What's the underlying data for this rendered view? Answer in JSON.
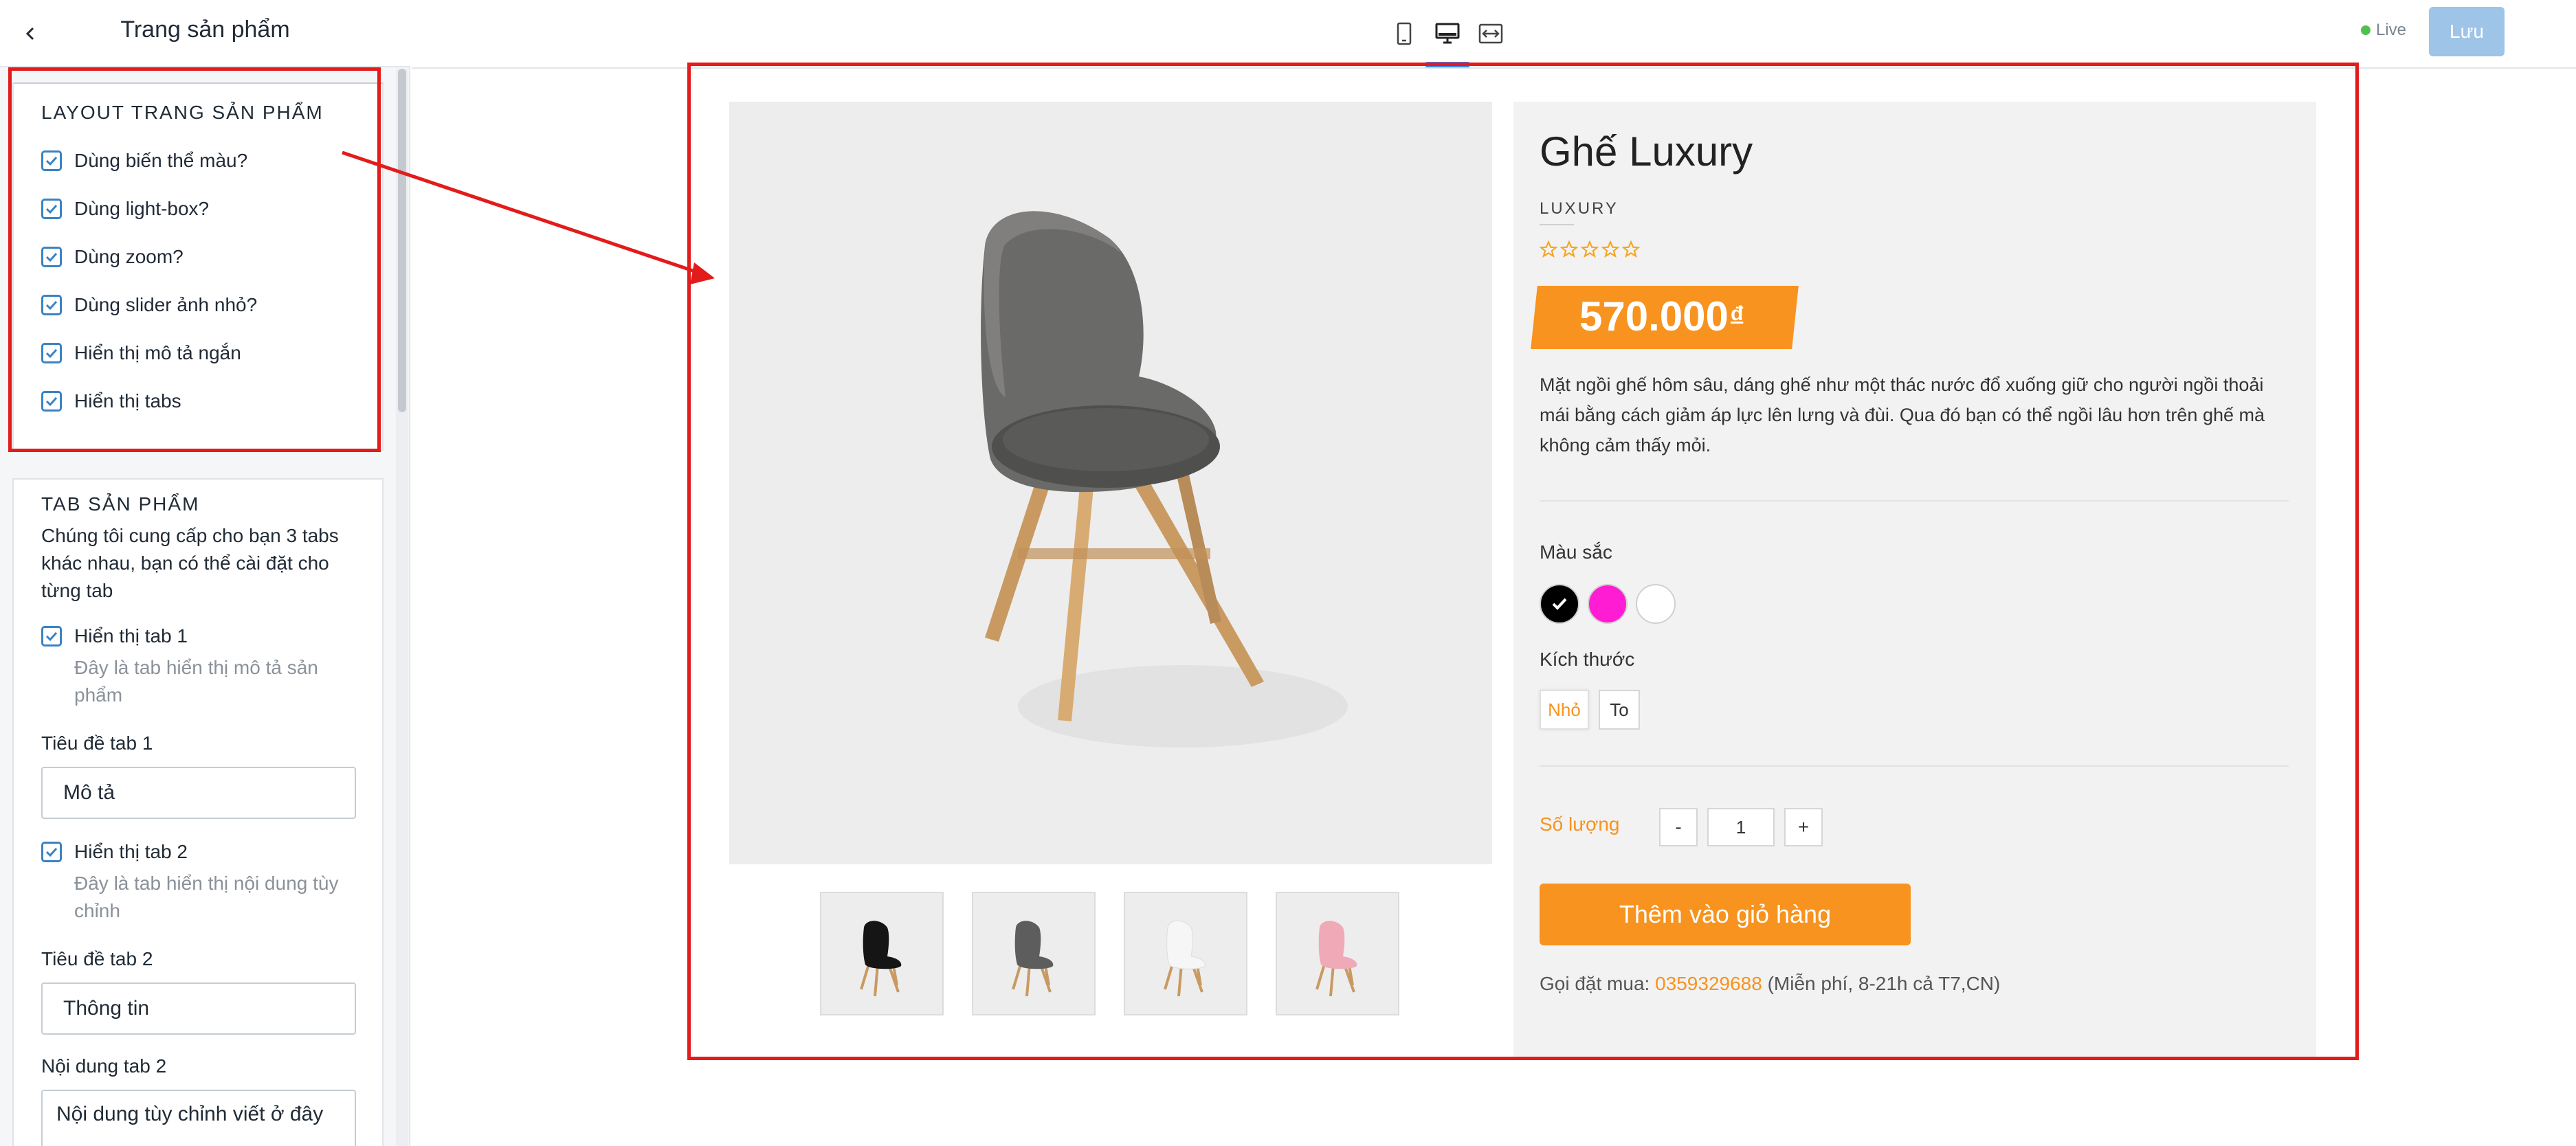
{
  "sidebar": {
    "title": "Trang sản phẩm",
    "layout_card": {
      "title": "LAYOUT TRANG SẢN PHẨM",
      "options": [
        {
          "label": "Dùng biến thể màu?",
          "checked": true
        },
        {
          "label": "Dùng light-box?",
          "checked": true
        },
        {
          "label": "Dùng zoom?",
          "checked": true
        },
        {
          "label": "Dùng slider ảnh nhỏ?",
          "checked": true
        },
        {
          "label": "Hiển thị mô tả ngắn",
          "checked": true
        },
        {
          "label": "Hiển thị tabs",
          "checked": true
        }
      ]
    },
    "tab_card": {
      "title": "TAB SẢN PHẨM",
      "description": "Chúng tôi cung cấp cho bạn 3 tabs khác nhau, bạn có thể cài đặt cho từng tab",
      "tab1_toggle": {
        "label": "Hiển thị tab 1",
        "help": "Đây là tab hiển thị mô tả sản phẩm",
        "checked": true
      },
      "tab1_title": {
        "label": "Tiêu đề tab 1",
        "value": "Mô tả"
      },
      "tab2_toggle": {
        "label": "Hiển thị tab 2",
        "help": "Đây là tab hiển thị nội dung tùy chỉnh",
        "checked": true
      },
      "tab2_title": {
        "label": "Tiêu đề tab 2",
        "value": "Thông tin"
      },
      "tab2_content": {
        "label": "Nội dung tab 2",
        "value": "Nội dung tùy chỉnh viết ở đây"
      }
    }
  },
  "topbar": {
    "devices": [
      "mobile-icon",
      "desktop-icon",
      "fullwidth-icon"
    ],
    "live_label": "Live",
    "save_label": "Lưu"
  },
  "product": {
    "title": "Ghế Luxury",
    "brand": "LUXURY",
    "rating_stars": 5,
    "rating_filled": 0,
    "price": "570.000",
    "currency": "đ",
    "description": "Mặt ngồi ghế hôm sâu, dáng ghế như một thác nước đổ xuống giữ cho người ngồi thoải mái bằng cách giảm áp lực lên lưng và đùi. Qua đó bạn có thể ngồi lâu hơn trên ghế mà không cảm thấy mỏi.",
    "color_label": "Màu sắc",
    "colors": [
      {
        "name": "black",
        "hex": "#000000",
        "selected": true
      },
      {
        "name": "magenta",
        "hex": "#ff1cd2",
        "selected": false
      },
      {
        "name": "white",
        "hex": "#ffffff",
        "selected": false
      }
    ],
    "size_label": "Kích thước",
    "sizes": [
      {
        "label": "Nhỏ",
        "selected": true
      },
      {
        "label": "To",
        "selected": false
      }
    ],
    "qty_label": "Số lượng",
    "qty_minus": "-",
    "qty_value": "1",
    "qty_plus": "+",
    "cart_label": "Thêm vào giỏ hàng",
    "call_prefix": "Gọi đặt mua:",
    "call_phone": "0359329688",
    "call_suffix": "(Miễn phí, 8-21h cả T7,CN)",
    "thumbnails": [
      {
        "name": "black-chair",
        "seat": "#151515"
      },
      {
        "name": "gray-chair",
        "seat": "#5d5d5d"
      },
      {
        "name": "white-chair",
        "seat": "#f4f4f4"
      },
      {
        "name": "pink-chair",
        "seat": "#f0a9b6"
      }
    ]
  },
  "colors": {
    "accent": "#f7931e",
    "checkbox": "#3b82c4",
    "annotation": "#e31b1b",
    "save_button": "#9ec4e7"
  }
}
